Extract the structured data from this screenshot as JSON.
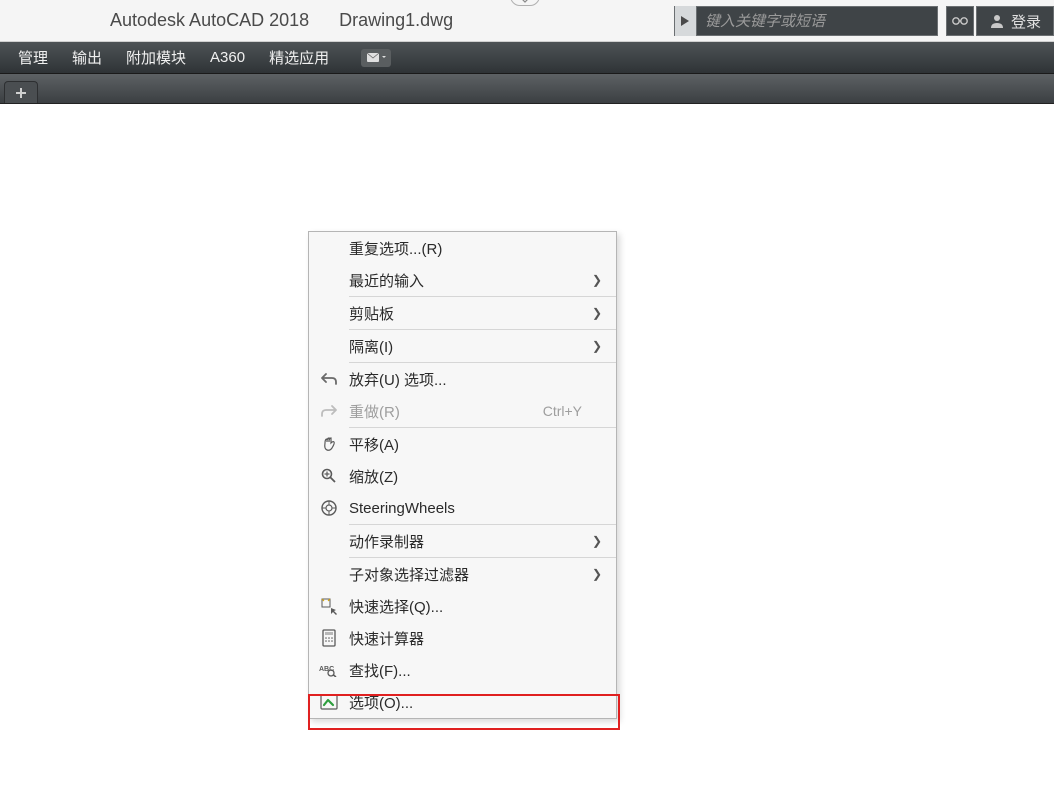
{
  "title": {
    "app": "Autodesk AutoCAD 2018",
    "doc": "Drawing1.dwg"
  },
  "search": {
    "placeholder": "键入关键字或短语"
  },
  "login": {
    "label": "登录"
  },
  "menu": {
    "items": [
      "管理",
      "输出",
      "附加模块",
      "A360",
      "精选应用"
    ]
  },
  "context_menu": {
    "items": [
      {
        "label": "重复选项...(R)",
        "icon": null,
        "submenu": false
      },
      {
        "label": "最近的输入",
        "icon": null,
        "submenu": true
      },
      {
        "sep": true
      },
      {
        "label": "剪贴板",
        "icon": null,
        "submenu": true
      },
      {
        "sep": true
      },
      {
        "label": "隔离(I)",
        "icon": null,
        "submenu": true
      },
      {
        "sep": true
      },
      {
        "label": "放弃(U) 选项...",
        "icon": "undo",
        "submenu": false
      },
      {
        "label": "重做(R)",
        "icon": "redo",
        "submenu": false,
        "shortcut": "Ctrl+Y",
        "disabled": true
      },
      {
        "sep": true
      },
      {
        "label": "平移(A)",
        "icon": "pan",
        "submenu": false
      },
      {
        "label": "缩放(Z)",
        "icon": "zoom",
        "submenu": false
      },
      {
        "label": "SteeringWheels",
        "icon": "wheel",
        "submenu": false
      },
      {
        "sep": true
      },
      {
        "label": "动作录制器",
        "icon": null,
        "submenu": true
      },
      {
        "sep": true
      },
      {
        "label": "子对象选择过滤器",
        "icon": null,
        "submenu": true
      },
      {
        "label": "快速选择(Q)...",
        "icon": "qselect",
        "submenu": false
      },
      {
        "label": "快速计算器",
        "icon": "calc",
        "submenu": false
      },
      {
        "label": "查找(F)...",
        "icon": "find",
        "submenu": false
      },
      {
        "label": "选项(O)...",
        "icon": "options",
        "submenu": false
      }
    ]
  }
}
